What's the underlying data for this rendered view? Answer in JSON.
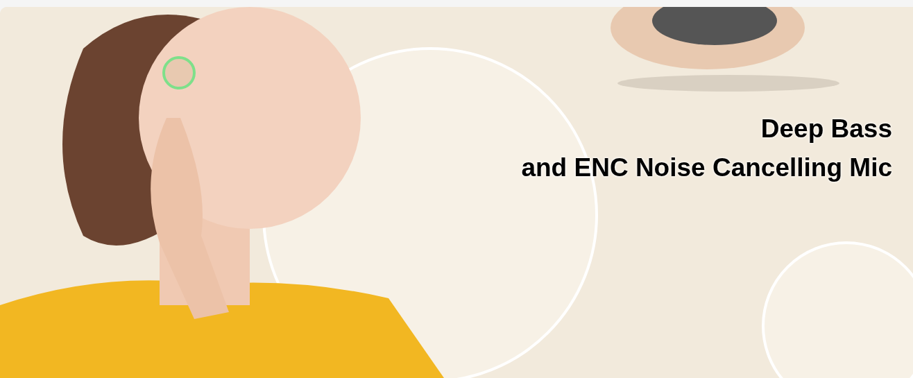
{
  "banner": {
    "kind": "picture",
    "headline": [
      "Deep Bass",
      "and ENC Noise Cancelling Mic"
    ]
  }
}
